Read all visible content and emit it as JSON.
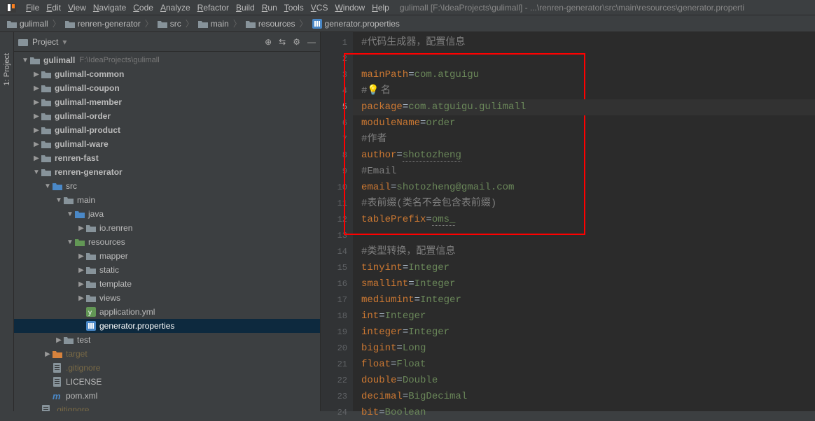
{
  "menu": [
    "File",
    "Edit",
    "View",
    "Navigate",
    "Code",
    "Analyze",
    "Refactor",
    "Build",
    "Run",
    "Tools",
    "VCS",
    "Window",
    "Help"
  ],
  "windowTitle": "gulimall [F:\\IdeaProjects\\gulimall] - ...\\renren-generator\\src\\main\\resources\\generator.properti",
  "breadcrumbs": [
    "gulimall",
    "renren-generator",
    "src",
    "main",
    "resources",
    "generator.properties"
  ],
  "projectLabel": "Project",
  "verticalTab": "1: Project",
  "tree": {
    "root": {
      "name": "gulimall",
      "path": "F:\\IdeaProjects\\gulimall"
    },
    "items": [
      {
        "indent": 0,
        "arrow": "▼",
        "icon": "folder",
        "name": "gulimall",
        "suffix": "F:\\IdeaProjects\\gulimall",
        "bold": true
      },
      {
        "indent": 1,
        "arrow": "▶",
        "icon": "folder",
        "name": "gulimall-common",
        "bold": true
      },
      {
        "indent": 1,
        "arrow": "▶",
        "icon": "folder",
        "name": "gulimall-coupon",
        "bold": true
      },
      {
        "indent": 1,
        "arrow": "▶",
        "icon": "folder",
        "name": "gulimall-member",
        "bold": true
      },
      {
        "indent": 1,
        "arrow": "▶",
        "icon": "folder",
        "name": "gulimall-order",
        "bold": true
      },
      {
        "indent": 1,
        "arrow": "▶",
        "icon": "folder",
        "name": "gulimall-product",
        "bold": true
      },
      {
        "indent": 1,
        "arrow": "▶",
        "icon": "folder",
        "name": "gulimall-ware",
        "bold": true
      },
      {
        "indent": 1,
        "arrow": "▶",
        "icon": "folder",
        "name": "renren-fast",
        "bold": true
      },
      {
        "indent": 1,
        "arrow": "▼",
        "icon": "folder",
        "name": "renren-generator",
        "bold": true
      },
      {
        "indent": 2,
        "arrow": "▼",
        "icon": "bluefolder",
        "name": "src"
      },
      {
        "indent": 3,
        "arrow": "▼",
        "icon": "folder",
        "name": "main"
      },
      {
        "indent": 4,
        "arrow": "▼",
        "icon": "bluefolder",
        "name": "java"
      },
      {
        "indent": 5,
        "arrow": "▶",
        "icon": "folder",
        "name": "io.renren"
      },
      {
        "indent": 4,
        "arrow": "▼",
        "icon": "greenfolder",
        "name": "resources"
      },
      {
        "indent": 5,
        "arrow": "▶",
        "icon": "folder",
        "name": "mapper"
      },
      {
        "indent": 5,
        "arrow": "▶",
        "icon": "folder",
        "name": "static"
      },
      {
        "indent": 5,
        "arrow": "▶",
        "icon": "folder",
        "name": "template"
      },
      {
        "indent": 5,
        "arrow": "▶",
        "icon": "folder",
        "name": "views"
      },
      {
        "indent": 5,
        "arrow": "",
        "icon": "yml",
        "name": "application.yml"
      },
      {
        "indent": 5,
        "arrow": "",
        "icon": "props",
        "name": "generator.properties",
        "selected": true
      },
      {
        "indent": 3,
        "arrow": "▶",
        "icon": "folder",
        "name": "test"
      },
      {
        "indent": 2,
        "arrow": "▶",
        "icon": "orangefolder",
        "name": "target",
        "faded": true
      },
      {
        "indent": 2,
        "arrow": "",
        "icon": "file",
        "name": ".gitignore",
        "faded": true
      },
      {
        "indent": 2,
        "arrow": "",
        "icon": "file",
        "name": "LICENSE"
      },
      {
        "indent": 2,
        "arrow": "",
        "icon": "maven",
        "name": "pom.xml"
      },
      {
        "indent": 1,
        "arrow": "",
        "icon": "file",
        "name": ".gitignore",
        "faded": true
      }
    ]
  },
  "editor": {
    "currentLine": 5,
    "lines": [
      {
        "n": 1,
        "type": "comment",
        "text": "#代码生成器，配置信息"
      },
      {
        "n": 2,
        "type": "blank"
      },
      {
        "n": 3,
        "type": "prop",
        "key": "mainPath",
        "val": "com.atguigu",
        "ul": true
      },
      {
        "n": 4,
        "type": "comment",
        "text": "#",
        "bulb": true,
        "rest": "名"
      },
      {
        "n": 5,
        "type": "prop",
        "key": "package",
        "val": "com.atguigu.gulimall",
        "ul": true,
        "current": true
      },
      {
        "n": 6,
        "type": "prop",
        "key": "moduleName",
        "val": "order"
      },
      {
        "n": 7,
        "type": "comment",
        "text": "#作者"
      },
      {
        "n": 8,
        "type": "prop",
        "key": "author",
        "val": "shotozheng",
        "valul": true
      },
      {
        "n": 9,
        "type": "comment",
        "text": "#Email"
      },
      {
        "n": 10,
        "type": "prop",
        "key": "email",
        "val": "shotozheng@gmail.com"
      },
      {
        "n": 11,
        "type": "comment",
        "text": "#表前缀(类名不会包含表前缀)"
      },
      {
        "n": 12,
        "type": "prop",
        "key": "tablePrefix",
        "val": "oms_",
        "valul": true
      },
      {
        "n": 13,
        "type": "blank"
      },
      {
        "n": 14,
        "type": "comment",
        "text": "#类型转换，配置信息"
      },
      {
        "n": 15,
        "type": "prop",
        "key": "tinyint",
        "val": "Integer"
      },
      {
        "n": 16,
        "type": "prop",
        "key": "smallint",
        "val": "Integer"
      },
      {
        "n": 17,
        "type": "prop",
        "key": "mediumint",
        "val": "Integer"
      },
      {
        "n": 18,
        "type": "prop",
        "key": "int",
        "val": "Integer"
      },
      {
        "n": 19,
        "type": "prop",
        "key": "integer",
        "val": "Integer"
      },
      {
        "n": 20,
        "type": "prop",
        "key": "bigint",
        "val": "Long"
      },
      {
        "n": 21,
        "type": "prop",
        "key": "float",
        "val": "Float"
      },
      {
        "n": 22,
        "type": "prop",
        "key": "double",
        "val": "Double"
      },
      {
        "n": 23,
        "type": "prop",
        "key": "decimal",
        "val": "BigDecimal"
      },
      {
        "n": 24,
        "type": "prop",
        "key": "bit",
        "val": "Boolean"
      }
    ]
  }
}
